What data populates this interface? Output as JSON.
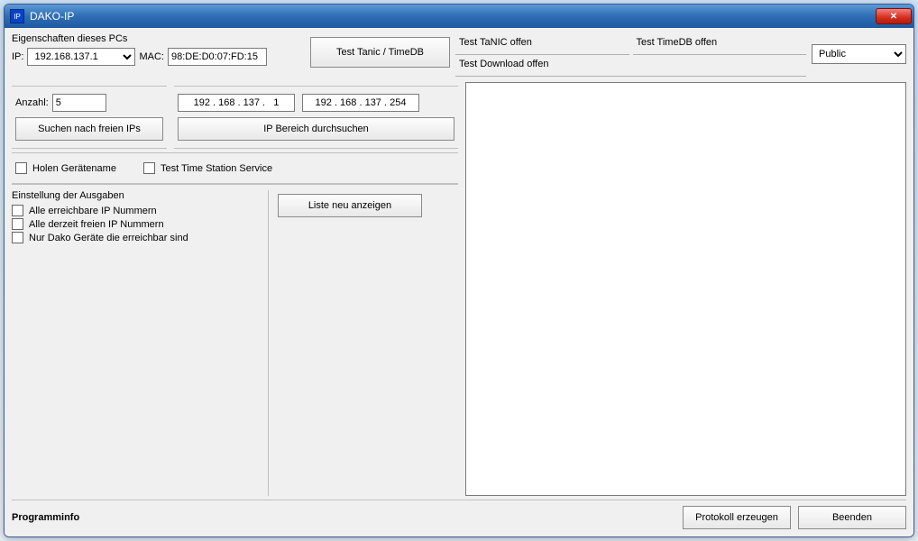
{
  "window": {
    "title": "DAKO-IP"
  },
  "pc": {
    "header": "Eigenschaften dieses PCs",
    "ip_label": "IP:",
    "ip_value": "192.168.137.1",
    "mac_label": "MAC:",
    "mac_value": "98:DE:D0:07:FD:15"
  },
  "buttons": {
    "test_tanic": "Test Tanic / TimeDB",
    "search_free": "Suchen nach freien IPs",
    "scan_range": "IP Bereich durchsuchen",
    "refresh_list": "Liste neu anzeigen",
    "protocol": "Protokoll erzeugen",
    "exit": "Beenden"
  },
  "status": {
    "tanic": "Test TaNIC offen",
    "timedb": "Test TimeDB offen",
    "download": "Test Download offen",
    "mode_value": "Public"
  },
  "search": {
    "count_label": "Anzahl:",
    "count_value": "5",
    "ip_from": "192 . 168 . 137 .   1",
    "ip_to": "192 . 168 . 137 . 254"
  },
  "options": {
    "get_devicename": "Holen Gerätename",
    "test_tss": "Test Time Station Service"
  },
  "output": {
    "header": "Einstellung der Ausgaben",
    "all_reachable": "Alle erreichbare IP Nummern",
    "all_free": "Alle derzeit freien IP Nummern",
    "only_dako": "Nur Dako Geräte die erreichbar sind"
  },
  "footer": {
    "programinfo": "Programminfo"
  }
}
